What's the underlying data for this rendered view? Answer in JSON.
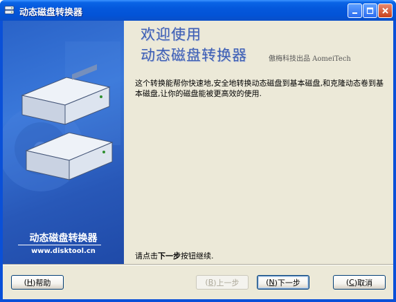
{
  "window": {
    "title": "动态磁盘转换器",
    "icon": "app-disk-icon",
    "controls": [
      "minimize-icon",
      "maximize-icon",
      "close-icon"
    ]
  },
  "banner": {
    "title": "动态磁盘转换器",
    "url": "www.disktool.cn",
    "image": "hard-disk-icon"
  },
  "main": {
    "welcome_line1": "欢迎使用",
    "welcome_line2": "动态磁盘转换器",
    "publisher": "傲梅科技出品 AomeiTech",
    "description": "这个转换能帮你快速地,安全地转换动态磁盘到基本磁盘,和克隆动态卷到基本磁盘,让你的磁盘能被更高效的使用.",
    "continue_prefix": "请点击",
    "continue_bold": "下一步",
    "continue_suffix": "按钮继续."
  },
  "buttons": {
    "help": {
      "prefix": "(",
      "accel": "H",
      "suffix": ")帮助"
    },
    "back": {
      "prefix": "(",
      "accel": "B",
      "suffix": ")上一步"
    },
    "next": {
      "prefix": "(",
      "accel": "N",
      "suffix": ")下一步"
    },
    "cancel": {
      "prefix": "(",
      "accel": "C",
      "suffix": ")取消"
    }
  },
  "colors": {
    "titlebar": "#0458dc",
    "banner": "#2a63c8",
    "heading": "#3e5fb3",
    "dialog_bg": "#ece9d8"
  }
}
